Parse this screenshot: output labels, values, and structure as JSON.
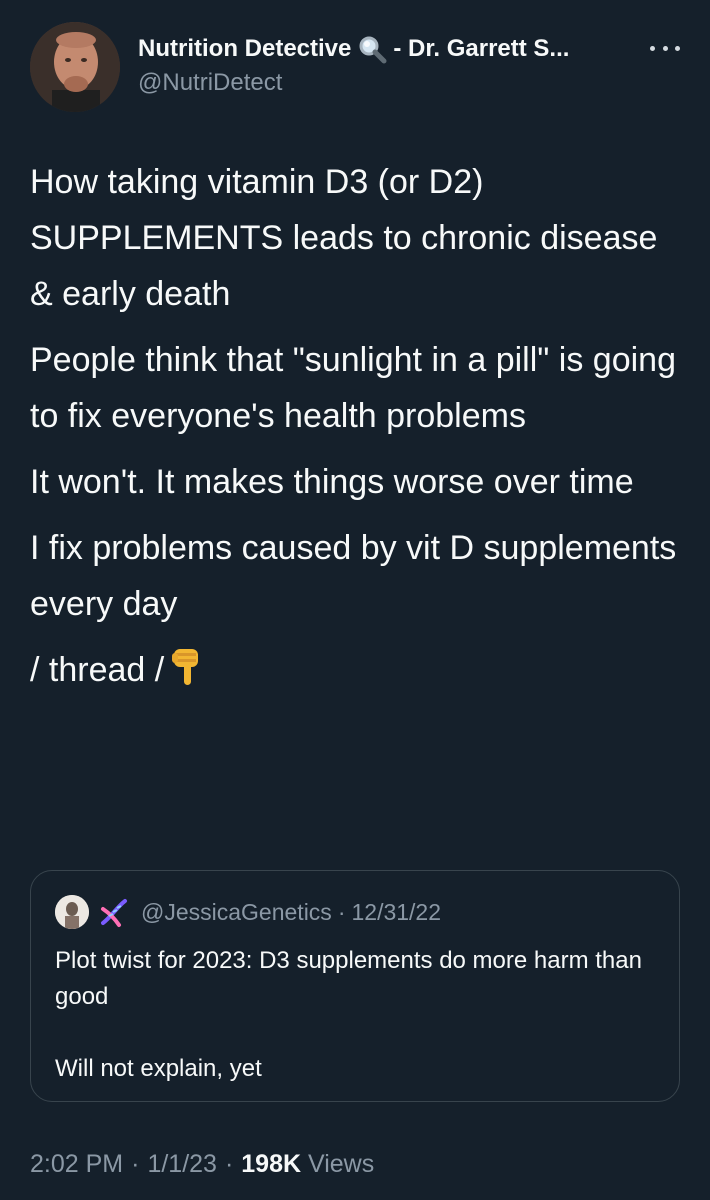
{
  "author": {
    "display_name": "Nutrition Detective",
    "display_name_suffix": "- Dr. Garrett S...",
    "handle": "@NutriDetect"
  },
  "tweet": {
    "paragraphs": [
      "How taking vitamin D3 (or D2) SUPPLEMENTS leads to chronic disease & early death",
      "People think that \"sunlight in a pill\" is going to fix everyone's health problems",
      "It won't. It makes things worse over time",
      "I fix problems caused by vit D supplements every day",
      "/ thread /"
    ]
  },
  "quoted_tweet": {
    "handle": "@JessicaGenetics",
    "separator": "·",
    "date": "12/31/22",
    "text_line_1": "Plot twist for 2023: D3 supplements do more harm than good",
    "text_line_2": "Will not explain, yet"
  },
  "meta": {
    "time": "2:02 PM",
    "separator": "·",
    "date": "1/1/23",
    "views_count": "198K",
    "views_label": "Views"
  },
  "icons": {
    "author_name_emoji": "magnifier-icon",
    "thread_emoji": "pointing-down-icon",
    "quoted_name_emoji": "dna-icon",
    "more": "more-icon"
  },
  "colors": {
    "background": "#15202b",
    "primary_text": "#f7f9f9",
    "secondary_text": "#8b98a5",
    "border": "#38444d"
  }
}
